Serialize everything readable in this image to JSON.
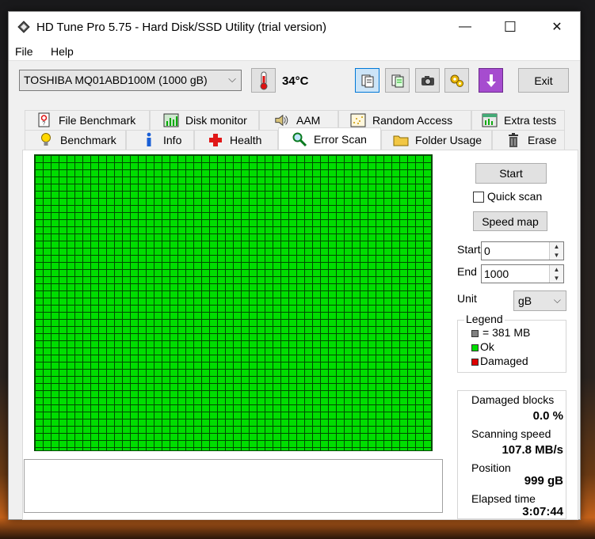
{
  "window": {
    "title": "HD Tune Pro 5.75 - Hard Disk/SSD Utility (trial version)",
    "minimize_glyph": "—",
    "maximize_glyph": "☐",
    "close_glyph": "✕"
  },
  "menu": {
    "file": "File",
    "help": "Help"
  },
  "toolbar": {
    "drive": "TOSHIBA MQ01ABD100M (1000 gB)",
    "temperature": "34°C",
    "exit_label": "Exit"
  },
  "tabs_row1": [
    {
      "label": "File Benchmark",
      "icon": "file-benchmark-icon"
    },
    {
      "label": "Disk monitor",
      "icon": "disk-monitor-icon"
    },
    {
      "label": "AAM",
      "icon": "speaker-icon"
    },
    {
      "label": "Random Access",
      "icon": "random-access-icon"
    },
    {
      "label": "Extra tests",
      "icon": "extra-tests-icon"
    }
  ],
  "tabs_row2": [
    {
      "label": "Benchmark",
      "icon": "lightbulb-icon"
    },
    {
      "label": "Info",
      "icon": "info-icon"
    },
    {
      "label": "Health",
      "icon": "health-cross-icon"
    },
    {
      "label": "Error Scan",
      "icon": "magnifier-icon",
      "active": true
    },
    {
      "label": "Folder Usage",
      "icon": "folder-icon"
    },
    {
      "label": "Erase",
      "icon": "trash-icon"
    }
  ],
  "controls": {
    "start_button": "Start",
    "quick_scan_label": "Quick scan",
    "quick_scan_checked": false,
    "speed_map_button": "Speed map",
    "start_label": "Start",
    "start_value": "0",
    "end_label": "End",
    "end_value": "1000",
    "unit_label": "Unit",
    "unit_value": "gB"
  },
  "legend": {
    "title": "Legend",
    "block_size": "= 381 MB",
    "ok": "Ok",
    "damaged": "Damaged",
    "colors": {
      "block": "#808080",
      "ok": "#00dd00",
      "damaged": "#dd0000"
    }
  },
  "stats": {
    "damaged_blocks_label": "Damaged blocks",
    "damaged_blocks_value": "0.0 %",
    "scanning_speed_label": "Scanning speed",
    "scanning_speed_value": "107.8 MB/s",
    "position_label": "Position",
    "position_value": "999 gB",
    "elapsed_label": "Elapsed time",
    "elapsed_value": "3:07:44"
  },
  "colors": {
    "grid_ok": "#00dd00",
    "grid_line": "#004a00",
    "accent": "#0078d7"
  }
}
